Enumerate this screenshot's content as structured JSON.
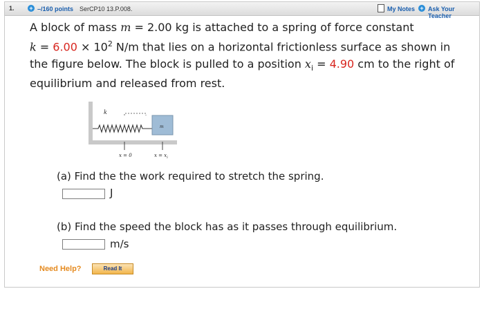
{
  "header": {
    "question_number": "1.",
    "points": "–/160 points",
    "assignment_id": "SerCP10 13.P.008.",
    "my_notes": "My Notes",
    "ask_teacher": "Ask Your Teacher"
  },
  "problem": {
    "l1_pre": "A block of mass ",
    "l1_var": "m",
    "l1_post": " = 2.00 kg is attached to a spring of force constant",
    "l2_var": "k",
    "l2_eq": " = ",
    "l2_val": "6.00",
    "l2_times": " × ",
    "l2_base": "10",
    "l2_exp": "2",
    "l2_post": " N/m that lies on a horizontal frictionless surface as shown in",
    "l3_pre": "the figure below. The block is pulled to a position ",
    "l3_var": "x",
    "l3_sub": "i",
    "l3_eq": " = ",
    "l3_val": "4.90",
    "l3_post": " cm to the right of",
    "l4": "equilibrium and released from rest."
  },
  "figure": {
    "k_label": "k",
    "mass_label": "m",
    "x0_label": "x = 0",
    "xi_label": "x = x",
    "xi_sub": "i"
  },
  "part_a": {
    "question": "(a) Find the the work required to stretch the spring.",
    "value": "",
    "unit": "J"
  },
  "part_b": {
    "question": "(b) Find the speed the block has as it passes through equilibrium.",
    "value": "",
    "unit": "m/s"
  },
  "help": {
    "label": "Need Help?",
    "button": "Read It"
  },
  "colors": {
    "link_blue": "#1b5fae",
    "given_red": "#d8261f",
    "help_orange": "#e58a1f"
  }
}
